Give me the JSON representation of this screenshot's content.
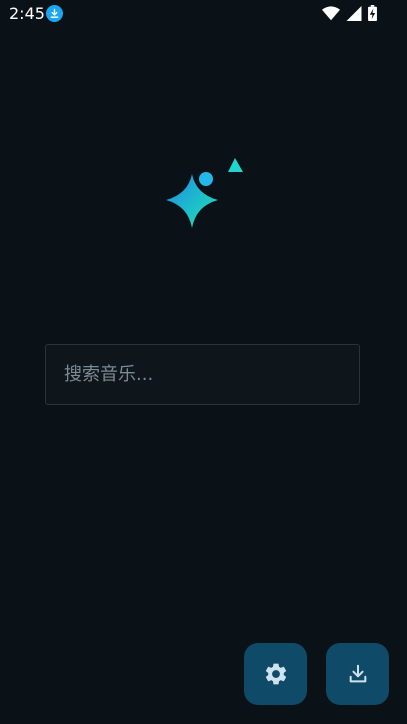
{
  "status_bar": {
    "time": "2:45",
    "icons": [
      "download-notification-icon",
      "wifi-icon",
      "signal-icon",
      "battery-charging-icon"
    ]
  },
  "search": {
    "placeholder": "搜索音乐...",
    "value": ""
  },
  "actions": {
    "settings_icon": "gear-icon",
    "download_icon": "download-icon"
  },
  "colors": {
    "background": "#0b1217",
    "accent": "#1aa7f0",
    "fab_background": "#0f4a68",
    "logo_gradient_start": "#1e88e5",
    "logo_gradient_end": "#1de9b6"
  }
}
